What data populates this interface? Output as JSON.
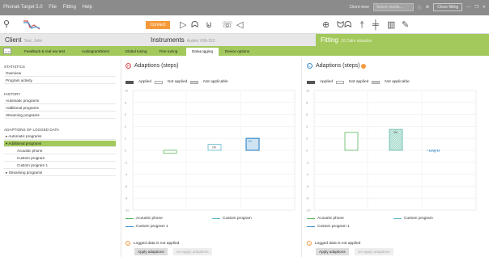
{
  "titlebar": {
    "app": "Phonak Target 5.0",
    "menu": [
      "File",
      "Fitting",
      "Help"
    ],
    "client_view": "Client view",
    "select_placeholder": "Select media...",
    "close_fitting": "Close fitting"
  },
  "toolbar": {
    "connect": "Connect"
  },
  "info": {
    "client_label": "Client",
    "client_name": "Test, John",
    "instruments_label": "Instruments",
    "instruments_value": "Audéo V90-312",
    "fitting_label": "Fitting",
    "fitting_value": "10 Calm situation"
  },
  "tabs": [
    "Feedback & real ear test",
    "AudiogramDirect",
    "Global tuning",
    "Fine tuning",
    "DataLogging",
    "Device options"
  ],
  "nav_label": "< >",
  "sidebar": {
    "statistics": "STATISTICS",
    "stat_items": [
      "Overview",
      "Program activity"
    ],
    "history": "HISTORY",
    "history_items": [
      "Automatic programs",
      "Additional programs",
      "Streaming programs"
    ],
    "adaptions": "ADAPTIONS OF LOGGED DATA",
    "adapt_items": [
      "Automatic programs",
      "Additional programs",
      "Acoustic phone",
      "Custom program",
      "Custom program 1",
      "Streaming programs"
    ]
  },
  "right": {
    "side": "R",
    "title": "Adaptions (steps)",
    "legend": [
      "Applied",
      "Not applied",
      "Not applicable"
    ],
    "yticks": [
      "10",
      "8",
      "6",
      "4",
      "2",
      "0",
      "-2",
      "-4",
      "-6",
      "-8",
      "-10"
    ],
    "bar_label": "1%",
    "bar_label2": "1%",
    "program_legend": [
      "Acoustic phone",
      "Custom program",
      "Custom program 1"
    ],
    "logged_note": "Logged data is not applied",
    "apply": "Apply adaptions",
    "unapply": "Un-apply adaptions"
  },
  "left": {
    "side": "L",
    "title": "Adaptions (steps)",
    "legend": [
      "Applied",
      "Not applied",
      "Not applicable"
    ],
    "yticks": [
      "10",
      "8",
      "6",
      "4",
      "2",
      "0",
      "-2",
      "-4",
      "-6",
      "-8",
      "-10"
    ],
    "bar_label": "1%",
    "bar_label2": "60 kg 10",
    "program_legend": [
      "Acoustic phone",
      "Custom program",
      "Custom program 1"
    ],
    "logged_note": "Logged data is not applied",
    "apply": "Apply adaptions",
    "unapply": "Un-apply adaptions"
  },
  "chart_data": [
    {
      "type": "bar",
      "title": "Adaptions (steps)",
      "ylim": [
        -10,
        10
      ],
      "series": [
        {
          "name": "Acoustic phone",
          "values": [
            -0.5
          ],
          "status": "Not applied",
          "color": "#5cb85c"
        },
        {
          "name": "Custom program",
          "values": [
            1
          ],
          "status": "Not applied",
          "color": "#5cb8c9"
        },
        {
          "name": "Custom program 1",
          "values": [
            2
          ],
          "status": "Applied",
          "color": "#3c8dc8"
        }
      ]
    },
    {
      "type": "bar",
      "title": "Adaptions (steps)",
      "ylim": [
        -10,
        10
      ],
      "series": [
        {
          "name": "Acoustic phone",
          "values": [
            3
          ],
          "status": "Not applied",
          "color": "#5cb85c"
        },
        {
          "name": "Custom program",
          "values": [
            3.5
          ],
          "status": "Not applicable",
          "color": "#5cb8a3"
        },
        {
          "name": "Custom program 1",
          "values": [
            0
          ],
          "status": "Applied",
          "color": "#3c8dc8"
        }
      ]
    }
  ]
}
